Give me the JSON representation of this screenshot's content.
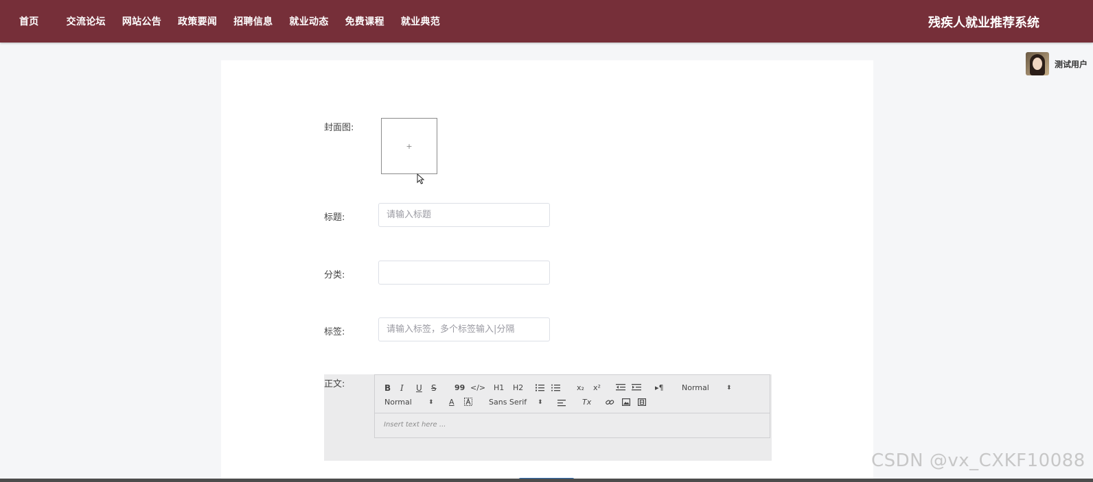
{
  "nav": {
    "items": [
      "首页",
      "交流论坛",
      "网站公告",
      "政策要闻",
      "招聘信息",
      "就业动态",
      "免费课程",
      "就业典范"
    ]
  },
  "site_title": "残疾人就业推荐系统",
  "user": {
    "name": "测试用户"
  },
  "form": {
    "cover_label": "封面图:",
    "upload_plus": "+",
    "title_label": "标题:",
    "title_placeholder": "请输入标题",
    "title_value": "",
    "category_label": "分类:",
    "category_value": "",
    "tags_label": "标签:",
    "tags_placeholder": "请输入标签，多个标签输入|分隔",
    "tags_value": "",
    "content_label": "正文:"
  },
  "editor": {
    "header_select": "Normal",
    "size_select": "Normal",
    "font_select": "Sans Serif",
    "placeholder": "Insert text here ...",
    "tools": {
      "bold": "B",
      "italic": "I",
      "underline": "U",
      "strike": "S",
      "quote": "99",
      "code": "</>",
      "h1": "H1",
      "h2": "H2",
      "subscript": "x₂",
      "superscript": "x²",
      "color": "A",
      "text_dir": "▸¶",
      "clean": "Tx",
      "caret": "⬍"
    }
  },
  "watermark": "CSDN @vx_CXKF10088",
  "colors": {
    "topbar": "#762f39",
    "panel": "#ffffff",
    "page_bg": "#f5f6f8"
  },
  "icons": [
    "plus-icon",
    "avatar-image",
    "cursor-icon",
    "bold-icon",
    "italic-icon",
    "underline-icon",
    "strike-icon",
    "quote-icon",
    "code-icon",
    "ordered-list-icon",
    "bullet-list-icon",
    "indent-icon",
    "outdent-icon",
    "link-icon",
    "image-icon",
    "video-icon",
    "align-icon",
    "clean-format-icon"
  ]
}
